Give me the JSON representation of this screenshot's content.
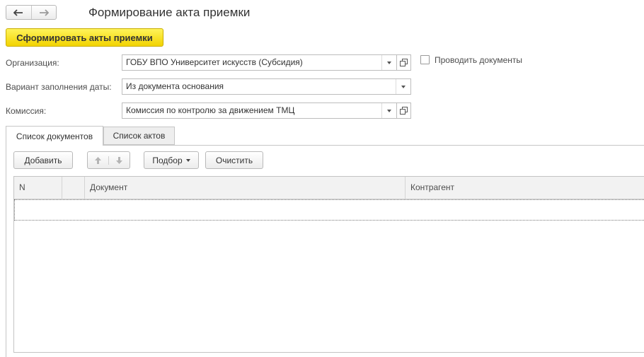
{
  "window": {
    "title": "Формирование акта приемки"
  },
  "nav": {
    "back_icon": "arrow-left-icon",
    "forward_icon": "arrow-right-icon"
  },
  "toolbar": {
    "create_label": "Сформировать акты приемки"
  },
  "form": {
    "organization": {
      "label": "Организация:",
      "value": "ГОБУ ВПО Университет искусств (Субсидия)"
    },
    "date_variant": {
      "label": "Вариант заполнения даты:",
      "value": "Из документа основания"
    },
    "commission": {
      "label": "Комиссия:",
      "value": "Комиссия по контролю за движением ТМЦ"
    },
    "post_documents": {
      "label": "Проводить документы",
      "checked": false
    }
  },
  "tabs": [
    {
      "label": "Список документов",
      "active": true
    },
    {
      "label": "Список актов",
      "active": false
    }
  ],
  "table_toolbar": {
    "add_label": "Добавить",
    "select_label": "Подбор",
    "clear_label": "Очистить"
  },
  "table": {
    "columns": [
      "N",
      "",
      "Документ",
      "Контрагент"
    ],
    "rows": []
  },
  "colors": {
    "accent_button": "#f5d800",
    "tab_inactive": "#eeeeee",
    "header_bg": "#f2f2f2"
  }
}
